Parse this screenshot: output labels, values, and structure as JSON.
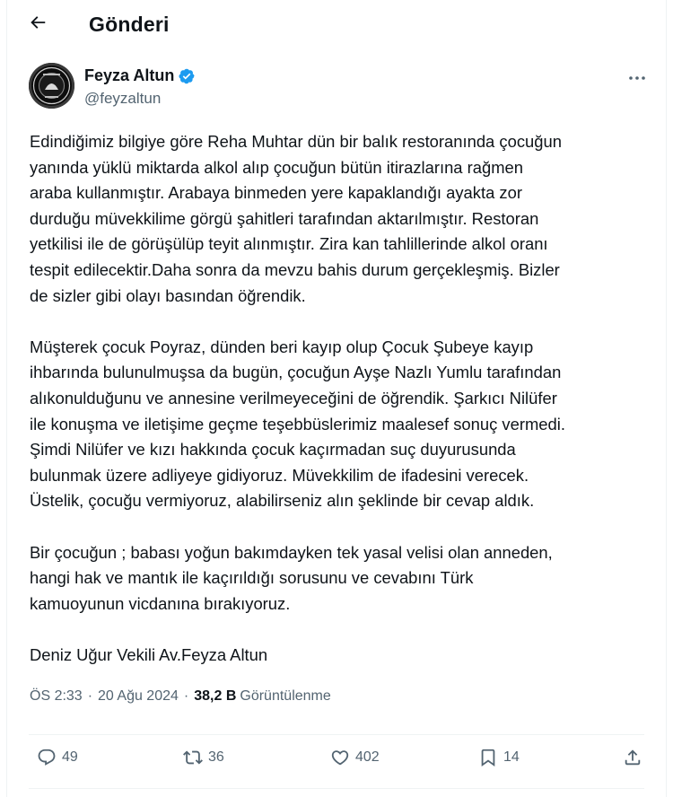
{
  "header": {
    "title": "Gönderi"
  },
  "author": {
    "name": "Feyza Altun",
    "handle": "@feyzaltun"
  },
  "tweet": {
    "paragraphs": [
      [
        "Edindiğimiz bilgiye göre Reha Muhtar dün bir balık restoranında çocuğun",
        "yanında yüklü miktarda alkol alıp çocuğun bütün itirazlarına rağmen",
        "araba kullanmıştır. Arabaya binmeden yere kapaklandığı ayakta zor",
        "durduğu müvekkilime görgü şahitleri tarafından aktarılmıştır. Restoran",
        "yetkilisi ile de görüşülüp teyit alınmıştır. Zira kan tahlillerinde alkol oranı",
        "tespit edilecektir.Daha sonra da mevzu bahis durum gerçekleşmiş. Bizler",
        "de sizler gibi olayı basından öğrendik."
      ],
      [
        "Müşterek çocuk Poyraz, dünden beri kayıp olup Çocuk Şubeye kayıp",
        "ihbarında bulunulmuşsa da bugün, çocuğun Ayşe Nazlı Yumlu tarafından",
        "alıkonulduğunu ve annesine verilmeyeceğini de öğrendik. Şarkıcı Nilüfer",
        "ile konuşma ve iletişime geçme teşebbüslerimiz maalesef sonuç vermedi.",
        "Şimdi Nilüfer ve kızı hakkında çocuk kaçırmadan suç duyurusunda",
        "bulunmak üzere adliyeye gidiyoruz. Müvekkilim de ifadesini verecek.",
        "Üstelik, çocuğu vermiyoruz, alabilirseniz alın şeklinde bir cevap aldık."
      ],
      [
        "Bir çocuğun ; babası yoğun bakımdayken tek yasal velisi olan anneden,",
        "hangi hak ve mantık ile  kaçırıldığı sorusunu ve cevabını Türk",
        "kamuoyunun vicdanına bırakıyoruz."
      ],
      [
        "Deniz Uğur Vekili Av.Feyza Altun"
      ]
    ]
  },
  "meta": {
    "time": "ÖS 2:33",
    "separator": "·",
    "date": "20 Ağu 2024",
    "views_count": "38,2 B",
    "views_label": "Görüntülenme"
  },
  "actions": {
    "replies": "49",
    "reposts": "36",
    "likes": "402",
    "bookmarks": "14"
  },
  "icons": {
    "back": "arrow-left-icon",
    "verified": "verified-badge-icon",
    "more": "more-horizontal-icon",
    "reply": "reply-icon",
    "repost": "repost-icon",
    "like": "heart-icon",
    "bookmark": "bookmark-icon",
    "share": "share-icon"
  },
  "colors": {
    "accent": "#1d9bf0",
    "text": "#0f1419",
    "secondary": "#536471",
    "border": "#eff3f4"
  }
}
